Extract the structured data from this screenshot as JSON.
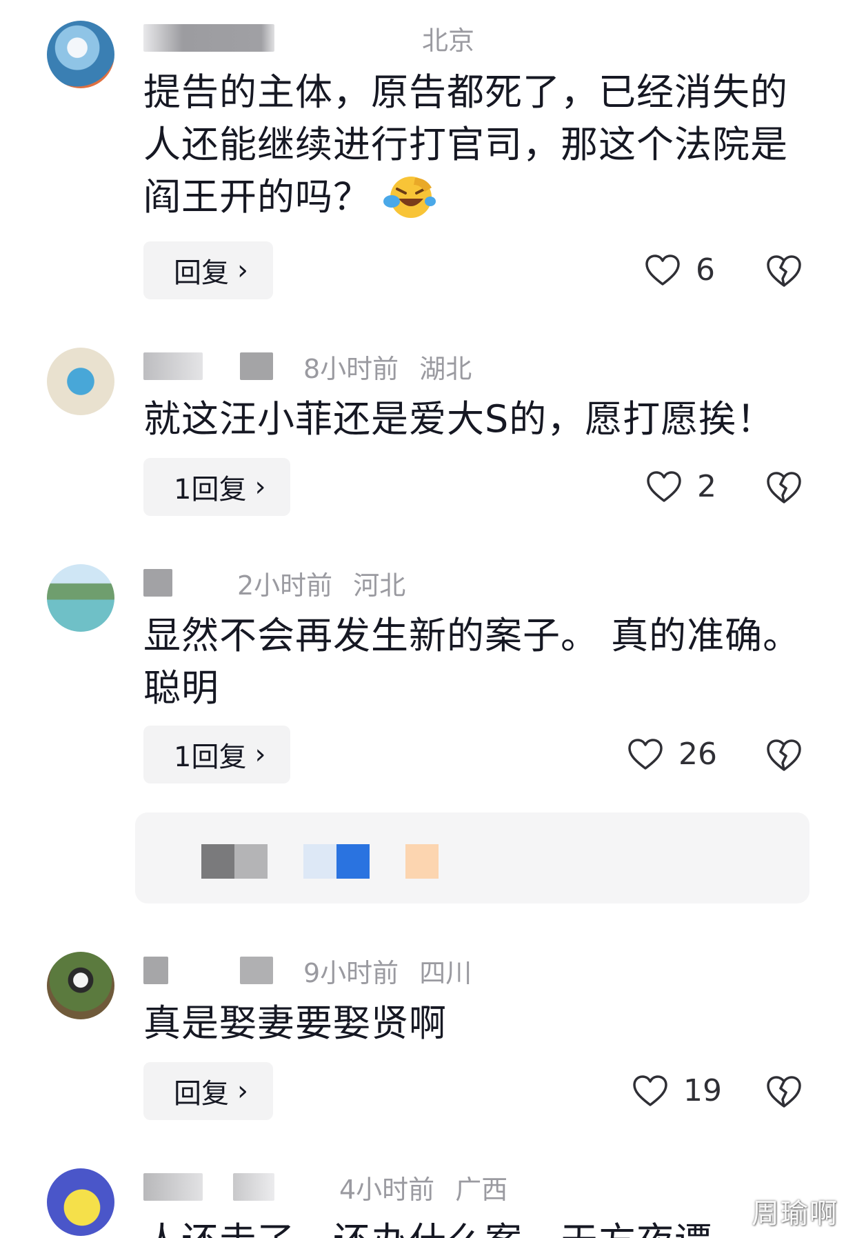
{
  "comments": [
    {
      "location": "北京",
      "time": "",
      "text_lines": [
        "提告的主体，原告都死了，已经消失的",
        "人还能继续进行打官司，那这个法院是",
        "阎王开的吗？"
      ],
      "emoji": "laughing-tears-emoji",
      "reply_label": "回复",
      "likes": "6"
    },
    {
      "location": "湖北",
      "time": "8小时前",
      "text_lines": [
        "就这汪小菲还是爱大S的，愿打愿挨！"
      ],
      "reply_label": "1回复",
      "likes": "2"
    },
    {
      "location": "河北",
      "time": "2小时前",
      "text_lines": [
        "显然不会再发生新的案子。 真的准确。",
        "聪明"
      ],
      "reply_label": "1回复",
      "likes": "26"
    },
    {
      "location": "四川",
      "time": "9小时前",
      "text_lines": [
        "真是娶妻要娶贤啊"
      ],
      "reply_label": "回复",
      "likes": "19"
    },
    {
      "location": "广西",
      "time": "4小时前",
      "text_lines": [
        "人还走了，还办什么案，天方夜谭"
      ]
    }
  ],
  "colors": {
    "text": "#161823",
    "meta": "#9a9aa0",
    "button_bg": "#f3f3f4",
    "ad_blue": "#2a73e0",
    "ad_peach": "#fcd5b0"
  },
  "watermark": "周瑜啊"
}
